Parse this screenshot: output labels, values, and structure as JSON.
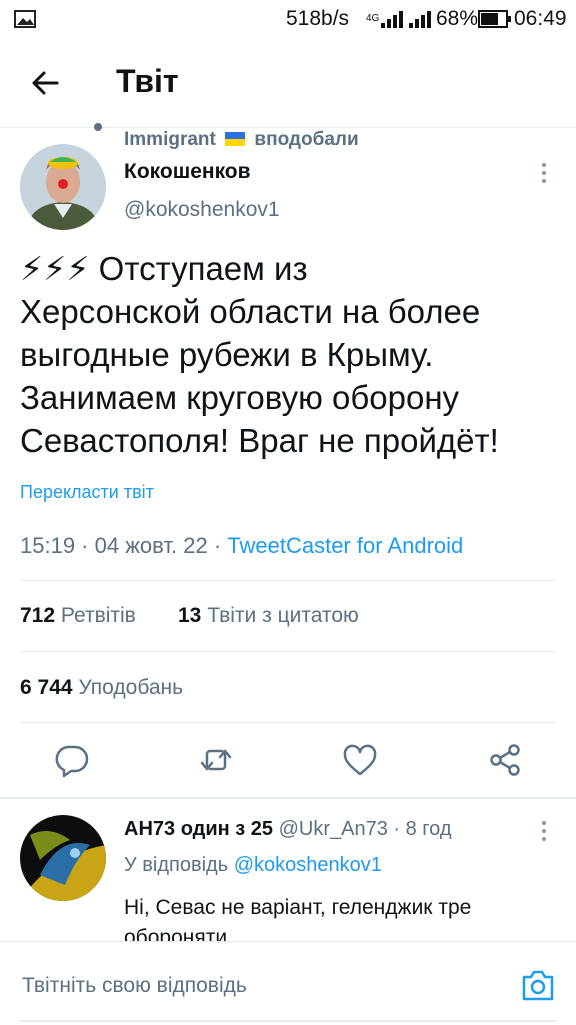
{
  "status_bar": {
    "speed": "518b/s",
    "network": "4G",
    "battery": "68%",
    "time": "06:49"
  },
  "header": {
    "title": "Твіт"
  },
  "social_context": {
    "user": "Immigrant",
    "action": "вподобали"
  },
  "tweet": {
    "author_name": "Кокошенков",
    "author_handle": "@kokoshenkov1",
    "text_line1": "⚡⚡⚡ Отступаем из",
    "text_line2": "Херсонской области на более",
    "text_line3": "выгодные рубежи в Крыму.",
    "text_line4": "Занимаем круговую оборону",
    "text_line5": "Севастополя! Враг не пройдёт!",
    "translate_link": "Перекласти твіт",
    "time": "15:19",
    "date": "04 жовт. 22",
    "source": "TweetCaster for Android",
    "retweets_count": "712",
    "retweets_label": "Ретвітів",
    "quotes_count": "13",
    "quotes_label": "Твіти з цитатою",
    "likes_count": "6 744",
    "likes_label": "Уподобань"
  },
  "reply": {
    "author_name": "АН73 один з 25",
    "author_handle": "@Ukr_An73",
    "time_ago": "8 год",
    "replying_to_label": "У відповідь",
    "replying_to_handle": "@kokoshenkov1",
    "text_line1": "Ні, Севас не варіант, геленджик тре",
    "text_line2": "обороняти..."
  },
  "composer": {
    "placeholder": "Твітніть свою відповідь"
  },
  "icons": {
    "back": "arrow-left-icon",
    "reply": "reply-icon",
    "retweet": "retweet-icon",
    "like": "heart-icon",
    "share": "share-icon",
    "camera": "camera-icon",
    "more": "more-vertical-icon"
  },
  "colors": {
    "accent": "#1d9bf0",
    "muted": "#5b7083",
    "text": "#0f1419"
  }
}
